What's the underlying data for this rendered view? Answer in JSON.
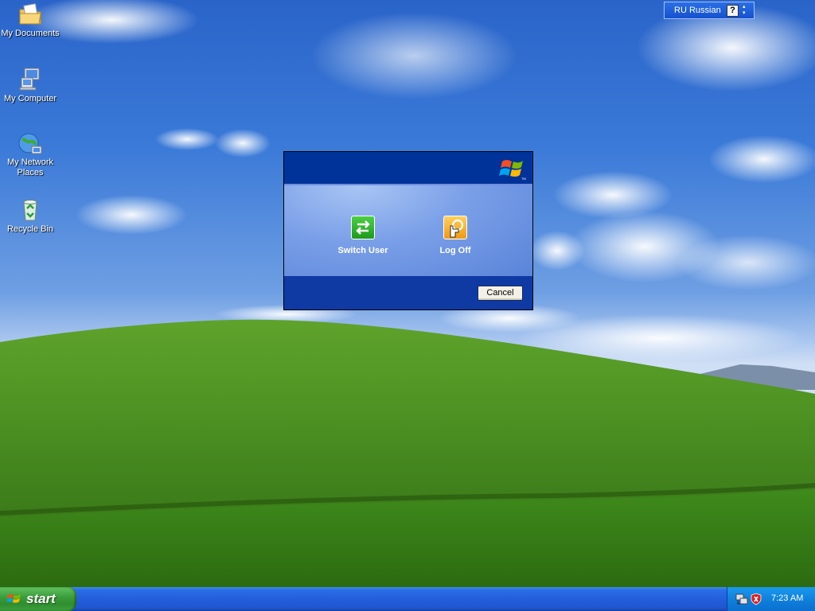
{
  "desktop": {
    "icons": [
      {
        "label": "My Documents",
        "icon": "my-documents-icon"
      },
      {
        "label": "My Computer",
        "icon": "my-computer-icon"
      },
      {
        "label": "My Network Places",
        "icon": "network-places-icon"
      },
      {
        "label": "Recycle Bin",
        "icon": "recycle-bin-icon"
      }
    ]
  },
  "language_bar": {
    "language": "RU Russian",
    "help_glyph": "?",
    "arrows": "▴\n▾"
  },
  "dialog": {
    "switch_user_label": "Switch User",
    "log_off_label": "Log Off",
    "cancel_label": "Cancel"
  },
  "taskbar": {
    "start_label": "start",
    "clock": "7:23 AM",
    "tray_icons": [
      "network-icon",
      "security-shield-icon"
    ]
  },
  "colors": {
    "dialog_dark": "#003399",
    "dialog_mid": "#7a9fe8",
    "taskbar": "#245edb",
    "start_green": "#3c9e3c",
    "tray": "#0f81dc"
  }
}
